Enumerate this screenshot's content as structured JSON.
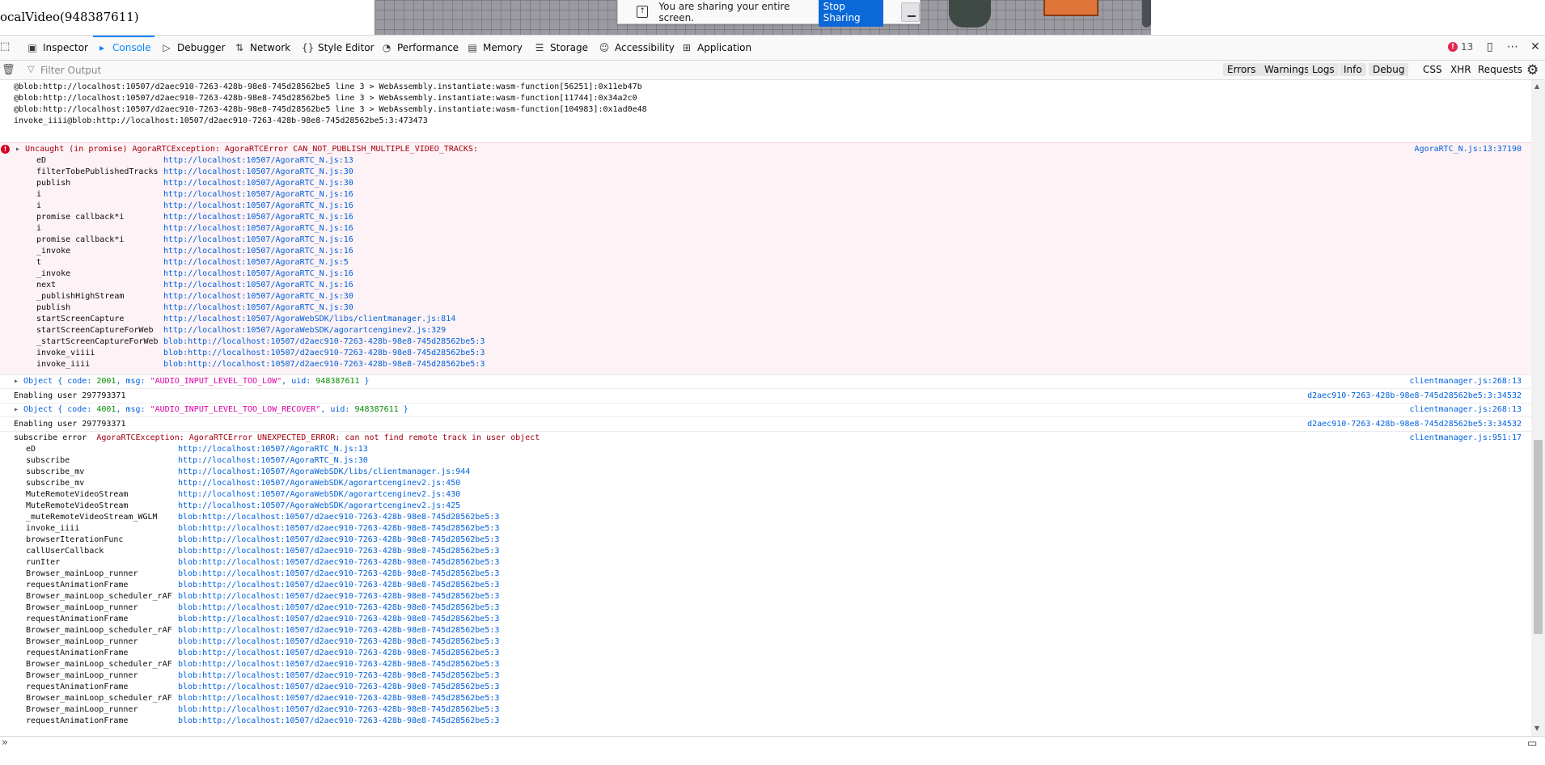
{
  "page": {
    "title": "ocalVideo(948387611)"
  },
  "share_bar": {
    "message": "You are sharing your entire screen.",
    "stop_label": "Stop Sharing",
    "icon": "share-screen-icon"
  },
  "toolbar": {
    "tabs": [
      {
        "label": "Inspector",
        "icon": "inspector-icon"
      },
      {
        "label": "Console",
        "icon": "console-icon"
      },
      {
        "label": "Debugger",
        "icon": "debugger-icon"
      },
      {
        "label": "Network",
        "icon": "network-icon"
      },
      {
        "label": "Style Editor",
        "icon": "style-editor-icon"
      },
      {
        "label": "Performance",
        "icon": "performance-icon"
      },
      {
        "label": "Memory",
        "icon": "memory-icon"
      },
      {
        "label": "Storage",
        "icon": "storage-icon"
      },
      {
        "label": "Accessibility",
        "icon": "accessibility-icon"
      },
      {
        "label": "Application",
        "icon": "application-icon"
      }
    ],
    "active_tab": "Console",
    "error_count": "13"
  },
  "filter": {
    "placeholder": "Filter Output",
    "levels": [
      "Errors",
      "Warnings",
      "Logs",
      "Info",
      "Debug"
    ],
    "categories": [
      "CSS",
      "XHR",
      "Requests"
    ]
  },
  "console": {
    "top_lines": [
      "@blob:http://localhost:10507/d2aec910-7263-428b-98e8-745d28562be5 line 3 > WebAssembly.instantiate:wasm-function[56251]:0x11eb47b",
      "@blob:http://localhost:10507/d2aec910-7263-428b-98e8-745d28562be5 line 3 > WebAssembly.instantiate:wasm-function[11744]:0x34a2c0",
      "@blob:http://localhost:10507/d2aec910-7263-428b-98e8-745d28562be5 line 3 > WebAssembly.instantiate:wasm-function[104983]:0x1ad0e48",
      "invoke_iiii@blob:http://localhost:10507/d2aec910-7263-428b-98e8-745d28562be5:3:473473"
    ],
    "error1": {
      "message": "Uncaught (in promise) AgoraRTCException: AgoraRTCError CAN_NOT_PUBLISH_MULTIPLE_VIDEO_TRACKS:",
      "source": "AgoraRTC_N.js:13:37190",
      "stack": [
        {
          "fn": "eD",
          "url": "http://localhost:10507/AgoraRTC_N.js:13"
        },
        {
          "fn": "filterTobePublishedTracks",
          "url": "http://localhost:10507/AgoraRTC_N.js:30"
        },
        {
          "fn": "publish",
          "url": "http://localhost:10507/AgoraRTC_N.js:30"
        },
        {
          "fn": "i",
          "url": "http://localhost:10507/AgoraRTC_N.js:16"
        },
        {
          "fn": "i",
          "url": "http://localhost:10507/AgoraRTC_N.js:16"
        },
        {
          "fn": "promise callback*i",
          "url": "http://localhost:10507/AgoraRTC_N.js:16"
        },
        {
          "fn": "i",
          "url": "http://localhost:10507/AgoraRTC_N.js:16"
        },
        {
          "fn": "promise callback*i",
          "url": "http://localhost:10507/AgoraRTC_N.js:16"
        },
        {
          "fn": "_invoke",
          "url": "http://localhost:10507/AgoraRTC_N.js:16"
        },
        {
          "fn": "t",
          "url": "http://localhost:10507/AgoraRTC_N.js:5"
        },
        {
          "fn": "_invoke",
          "url": "http://localhost:10507/AgoraRTC_N.js:16"
        },
        {
          "fn": "next",
          "url": "http://localhost:10507/AgoraRTC_N.js:16"
        },
        {
          "fn": "_publishHighStream",
          "url": "http://localhost:10507/AgoraRTC_N.js:30"
        },
        {
          "fn": "publish",
          "url": "http://localhost:10507/AgoraRTC_N.js:30"
        },
        {
          "fn": "startScreenCapture",
          "url": "http://localhost:10507/AgoraWebSDK/libs/clientmanager.js:814"
        },
        {
          "fn": "startScreenCaptureForWeb",
          "url": "http://localhost:10507/AgoraWebSDK/agorartcenginev2.js:329"
        },
        {
          "fn": "_startScreenCaptureForWeb",
          "url": "blob:http://localhost:10507/d2aec910-7263-428b-98e8-745d28562be5:3"
        },
        {
          "fn": "invoke_viiii",
          "url": "blob:http://localhost:10507/d2aec910-7263-428b-98e8-745d28562be5:3"
        },
        {
          "fn": "invoke_iiii",
          "url": "blob:http://localhost:10507/d2aec910-7263-428b-98e8-745d28562be5:3"
        }
      ]
    },
    "obj1": {
      "prefix": "Object { code: ",
      "code": "2001",
      "mid": ", msg: ",
      "msg": "\"AUDIO_INPUT_LEVEL_TOO_LOW\"",
      "mid2": ", uid: ",
      "uid": "948387611",
      "suffix": " }",
      "source": "clientmanager.js:268:13"
    },
    "enable1": {
      "text": "Enabling user 297793371",
      "source": "d2aec910-7263-428b-98e8-745d28562be5:3:34532"
    },
    "obj2": {
      "prefix": "Object { code: ",
      "code": "4001",
      "mid": ", msg: ",
      "msg": "\"AUDIO_INPUT_LEVEL_TOO_LOW_RECOVER\"",
      "mid2": ", uid: ",
      "uid": "948387611",
      "suffix": " }",
      "source": "clientmanager.js:268:13"
    },
    "enable2": {
      "text": "Enabling user 297793371",
      "source": "d2aec910-7263-428b-98e8-745d28562be5:3:34532"
    },
    "subscribe": {
      "label": "subscribe error",
      "message": "AgoraRTCException: AgoraRTCError UNEXPECTED_ERROR: can not find remote track in user object",
      "source": "clientmanager.js:951:17",
      "stack": [
        {
          "fn": "eD",
          "url": "http://localhost:10507/AgoraRTC_N.js:13"
        },
        {
          "fn": "subscribe",
          "url": "http://localhost:10507/AgoraRTC_N.js:30"
        },
        {
          "fn": "subscribe_mv",
          "url": "http://localhost:10507/AgoraWebSDK/libs/clientmanager.js:944"
        },
        {
          "fn": "subscribe_mv",
          "url": "http://localhost:10507/AgoraWebSDK/agorartcenginev2.js:450"
        },
        {
          "fn": "MuteRemoteVideoStream",
          "url": "http://localhost:10507/AgoraWebSDK/agorartcenginev2.js:430"
        },
        {
          "fn": "MuteRemoteVideoStream",
          "url": "http://localhost:10507/AgoraWebSDK/agorartcenginev2.js:425"
        },
        {
          "fn": "_muteRemoteVideoStream_WGLM",
          "url": "blob:http://localhost:10507/d2aec910-7263-428b-98e8-745d28562be5:3"
        },
        {
          "fn": "invoke_iiii",
          "url": "blob:http://localhost:10507/d2aec910-7263-428b-98e8-745d28562be5:3"
        },
        {
          "fn": "browserIterationFunc",
          "url": "blob:http://localhost:10507/d2aec910-7263-428b-98e8-745d28562be5:3"
        },
        {
          "fn": "callUserCallback",
          "url": "blob:http://localhost:10507/d2aec910-7263-428b-98e8-745d28562be5:3"
        },
        {
          "fn": "runIter",
          "url": "blob:http://localhost:10507/d2aec910-7263-428b-98e8-745d28562be5:3"
        },
        {
          "fn": "Browser_mainLoop_runner",
          "url": "blob:http://localhost:10507/d2aec910-7263-428b-98e8-745d28562be5:3"
        },
        {
          "fn": "requestAnimationFrame",
          "url": "blob:http://localhost:10507/d2aec910-7263-428b-98e8-745d28562be5:3"
        },
        {
          "fn": "Browser_mainLoop_scheduler_rAF",
          "url": "blob:http://localhost:10507/d2aec910-7263-428b-98e8-745d28562be5:3"
        },
        {
          "fn": "Browser_mainLoop_runner",
          "url": "blob:http://localhost:10507/d2aec910-7263-428b-98e8-745d28562be5:3"
        },
        {
          "fn": "requestAnimationFrame",
          "url": "blob:http://localhost:10507/d2aec910-7263-428b-98e8-745d28562be5:3"
        },
        {
          "fn": "Browser_mainLoop_scheduler_rAF",
          "url": "blob:http://localhost:10507/d2aec910-7263-428b-98e8-745d28562be5:3"
        },
        {
          "fn": "Browser_mainLoop_runner",
          "url": "blob:http://localhost:10507/d2aec910-7263-428b-98e8-745d28562be5:3"
        },
        {
          "fn": "requestAnimationFrame",
          "url": "blob:http://localhost:10507/d2aec910-7263-428b-98e8-745d28562be5:3"
        },
        {
          "fn": "Browser_mainLoop_scheduler_rAF",
          "url": "blob:http://localhost:10507/d2aec910-7263-428b-98e8-745d28562be5:3"
        },
        {
          "fn": "Browser_mainLoop_runner",
          "url": "blob:http://localhost:10507/d2aec910-7263-428b-98e8-745d28562be5:3"
        },
        {
          "fn": "requestAnimationFrame",
          "url": "blob:http://localhost:10507/d2aec910-7263-428b-98e8-745d28562be5:3"
        },
        {
          "fn": "Browser_mainLoop_scheduler_rAF",
          "url": "blob:http://localhost:10507/d2aec910-7263-428b-98e8-745d28562be5:3"
        },
        {
          "fn": "Browser_mainLoop_runner",
          "url": "blob:http://localhost:10507/d2aec910-7263-428b-98e8-745d28562be5:3"
        },
        {
          "fn": "requestAnimationFrame",
          "url": "blob:http://localhost:10507/d2aec910-7263-428b-98e8-745d28562be5:3"
        }
      ]
    }
  }
}
